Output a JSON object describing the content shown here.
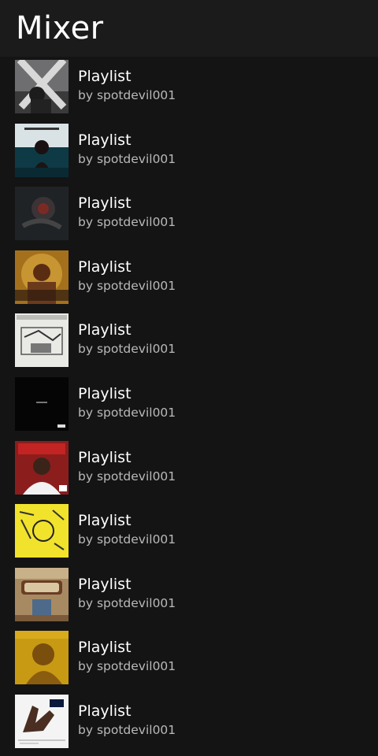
{
  "header": {
    "title": "Mixer"
  },
  "playlists": [
    {
      "title": "Playlist",
      "owner": "by spotdevil001",
      "cover": "cover-x-gray"
    },
    {
      "title": "Playlist",
      "owner": "by spotdevil001",
      "cover": "cover-teal-figure"
    },
    {
      "title": "Playlist",
      "owner": "by spotdevil001",
      "cover": "cover-dark-red"
    },
    {
      "title": "Playlist",
      "owner": "by spotdevil001",
      "cover": "cover-gold-portrait"
    },
    {
      "title": "Playlist",
      "owner": "by spotdevil001",
      "cover": "cover-sketch-white"
    },
    {
      "title": "Playlist",
      "owner": "by spotdevil001",
      "cover": "cover-black-minimal"
    },
    {
      "title": "Playlist",
      "owner": "by spotdevil001",
      "cover": "cover-red-portrait"
    },
    {
      "title": "Playlist",
      "owner": "by spotdevil001",
      "cover": "cover-yellow-sketch"
    },
    {
      "title": "Playlist",
      "owner": "by spotdevil001",
      "cover": "cover-tan-lettering"
    },
    {
      "title": "Playlist",
      "owner": "by spotdevil001",
      "cover": "cover-amber-portrait"
    },
    {
      "title": "Playlist",
      "owner": "by spotdevil001",
      "cover": "cover-hand-drawing"
    }
  ]
}
